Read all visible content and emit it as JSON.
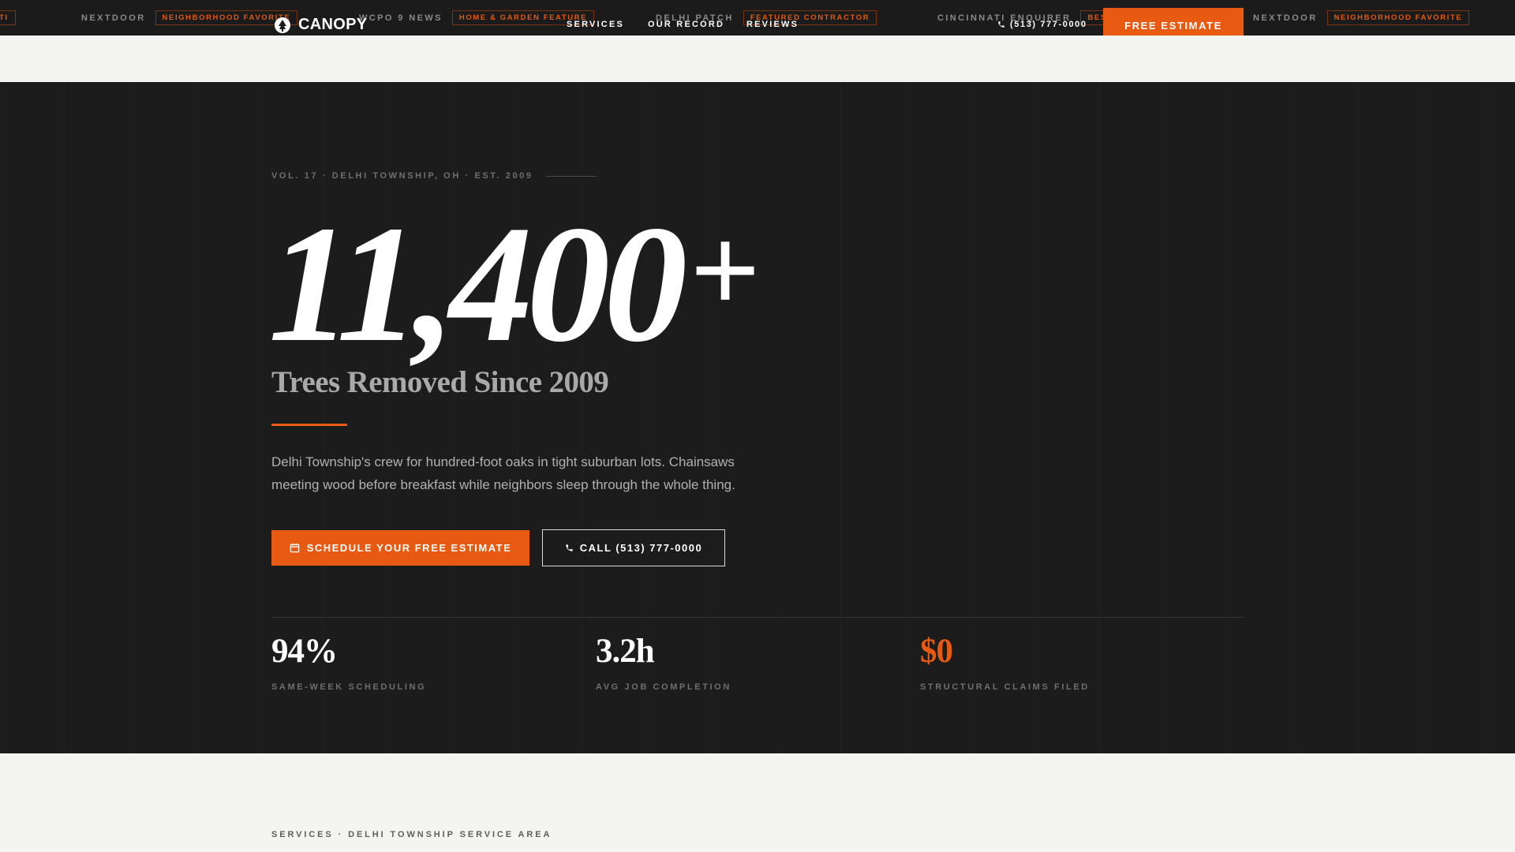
{
  "ticker": {
    "items": [
      {
        "name": "",
        "badge": "TI"
      },
      {
        "name": "NEXTDOOR",
        "badge": "NEIGHBORHOOD FAVORITE"
      },
      {
        "name": "WCPO 9 NEWS",
        "badge": "HOME & GARDEN FEATURE"
      },
      {
        "name": "DELHI PATCH",
        "badge": "FEATURED CONTRACTOR"
      },
      {
        "name": "CINCINNATI ENQUIRER",
        "badge": "BEST"
      },
      {
        "name": "NEXTDOOR",
        "badge": "NEIGHBORHOOD FAVORITE"
      }
    ]
  },
  "nav": {
    "brand": "CANOPY",
    "brand_icon": "tree-icon",
    "links": [
      "SERVICES",
      "OUR RECORD",
      "REVIEWS"
    ],
    "phone": "(513) 777-0000",
    "phone_icon": "phone-icon",
    "cta": "FREE ESTIMATE"
  },
  "hero": {
    "eyebrow": "VOL. 17 · DELHI TOWNSHIP, OH · EST. 2009",
    "big_number": "11,400",
    "big_suffix": "+",
    "subtitle": "Trees Removed Since 2009",
    "description": "Delhi Township's crew for hundred-foot oaks in tight suburban lots. Chainsaws meeting wood before breakfast while neighbors sleep through the whole thing.",
    "primary_cta": "SCHEDULE YOUR FREE ESTIMATE",
    "primary_icon": "calendar-icon",
    "secondary_cta": "CALL (513) 777-0000",
    "secondary_icon": "phone-icon",
    "stats": [
      {
        "value": "94%",
        "label": "SAME-WEEK SCHEDULING",
        "accent": false
      },
      {
        "value": "3.2h",
        "label": "AVG JOB COMPLETION",
        "accent": false
      },
      {
        "value": "$0",
        "label": "STRUCTURAL CLAIMS FILED",
        "accent": true
      }
    ]
  },
  "next_section": {
    "eyebrow": "SERVICES · DELHI TOWNSHIP SERVICE AREA"
  },
  "colors": {
    "accent": "#e85a12",
    "dark": "#1c1c1c",
    "light": "#f4f4f2"
  }
}
